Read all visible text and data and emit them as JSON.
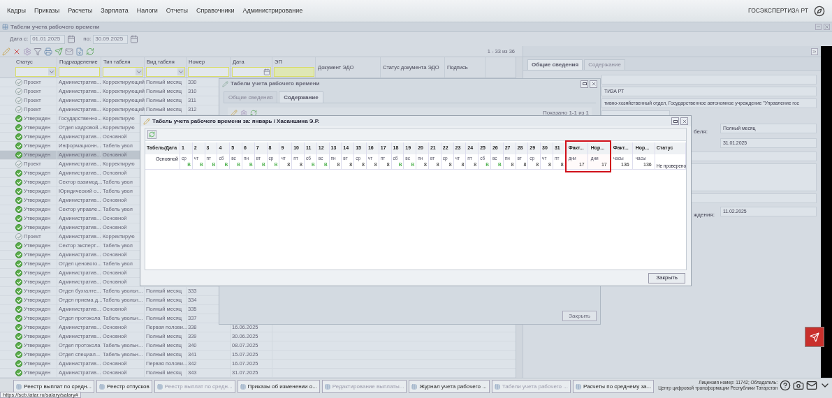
{
  "menu": {
    "items": [
      "Кадры",
      "Приказы",
      "Расчеты",
      "Зарплата",
      "Налоги",
      "Отчеты",
      "Справочники",
      "Администрирование"
    ],
    "org": "ГОСЭКСПЕРТИЗА РТ"
  },
  "panel": {
    "title": "Табели учета рабочего времени",
    "date_from_label": "Дата с:",
    "date_from": "01.01.2025",
    "date_to_label": "по:",
    "date_to": "30.09.2025",
    "pager": "1 - 33 из 36"
  },
  "grid": {
    "columns": [
      {
        "label": "Статус",
        "kind": "select"
      },
      {
        "label": "Подразделение",
        "kind": "text"
      },
      {
        "label": "Тип табеля",
        "kind": "select"
      },
      {
        "label": "Вид табеля",
        "kind": "select"
      },
      {
        "label": "Номер",
        "kind": "text"
      },
      {
        "label": "Дата",
        "kind": "date"
      },
      {
        "label": "ЭП",
        "kind": "sign"
      },
      {
        "label": "Документ ЭДО",
        "kind": "none"
      },
      {
        "label": "Статус документа ЭДО",
        "kind": "none"
      },
      {
        "label": "Подпись",
        "kind": "none"
      }
    ],
    "rows": [
      {
        "status": "Проект",
        "kind": "draft",
        "selected": false,
        "department": "Административ...",
        "type": "Корректирующий",
        "view": "Полный месяц",
        "number": "330"
      },
      {
        "status": "Проект",
        "kind": "draft",
        "selected": false,
        "department": "Административ...",
        "type": "Корректирующий",
        "view": "Полный месяц",
        "number": "310"
      },
      {
        "status": "Проект",
        "kind": "draft",
        "selected": false,
        "department": "Административ...",
        "type": "Корректирующий",
        "view": "Полный месяц",
        "number": "311"
      },
      {
        "status": "Проект",
        "kind": "draft",
        "selected": false,
        "department": "Административ...",
        "type": "Корректирующий",
        "view": "Полный месяц",
        "number": "312"
      },
      {
        "status": "Утвержден",
        "kind": "approved",
        "selected": false,
        "department": "Государственно...",
        "type": "Корректирую"
      },
      {
        "status": "Утвержден",
        "kind": "approved",
        "selected": false,
        "department": "Отдел кадровой...",
        "type": "Корректирую"
      },
      {
        "status": "Утвержден",
        "kind": "approved",
        "selected": false,
        "department": "Административ...",
        "type": "Основной"
      },
      {
        "status": "Утвержден",
        "kind": "approved",
        "selected": false,
        "department": "Информационн...",
        "type": "Табель увол"
      },
      {
        "status": "Утвержден",
        "kind": "approved",
        "selected": true,
        "department": "Административ...",
        "type": "Основной"
      },
      {
        "status": "Проект",
        "kind": "draft",
        "selected": false,
        "department": "Административ...",
        "type": "Корректирую"
      },
      {
        "status": "Утвержден",
        "kind": "approved",
        "selected": false,
        "department": "Административ...",
        "type": "Основной"
      },
      {
        "status": "Утвержден",
        "kind": "approved",
        "selected": false,
        "department": "Сектор взаимод...",
        "type": "Табель увол"
      },
      {
        "status": "Утвержден",
        "kind": "approved",
        "selected": false,
        "department": "Юридический о...",
        "type": "Табель увол"
      },
      {
        "status": "Утвержден",
        "kind": "approved",
        "selected": false,
        "department": "Административ...",
        "type": "Основной"
      },
      {
        "status": "Утвержден",
        "kind": "approved",
        "selected": false,
        "department": "Сектор управле...",
        "type": "Табель увол"
      },
      {
        "status": "Утвержден",
        "kind": "approved",
        "selected": false,
        "department": "Административ...",
        "type": "Основной"
      },
      {
        "status": "Утвержден",
        "kind": "approved",
        "selected": false,
        "department": "Административ...",
        "type": "Основной"
      },
      {
        "status": "Проект",
        "kind": "draft",
        "selected": false,
        "department": "Административ...",
        "type": "Корректирую"
      },
      {
        "status": "Утвержден",
        "kind": "approved",
        "selected": false,
        "department": "Сектор эксперт...",
        "type": "Табель увол"
      },
      {
        "status": "Утвержден",
        "kind": "approved",
        "selected": false,
        "department": "Административ...",
        "type": "Основной"
      },
      {
        "status": "Утвержден",
        "kind": "approved",
        "selected": false,
        "department": "Отдел ценового...",
        "type": "Табель увол"
      },
      {
        "status": "Утвержден",
        "kind": "approved",
        "selected": false,
        "department": "Административ...",
        "type": "Основной"
      },
      {
        "status": "Утвержден",
        "kind": "approved",
        "selected": false,
        "department": "Административ...",
        "type": "Основной"
      },
      {
        "status": "Утвержден",
        "kind": "approved",
        "selected": false,
        "department": "Отдел бухгалте...",
        "type": "Табель увольн...",
        "view": "Полный месяц",
        "number": "333"
      },
      {
        "status": "Утвержден",
        "kind": "approved",
        "selected": false,
        "department": "Отдел приема д...",
        "type": "Табель увольн...",
        "view": "Полный месяц",
        "number": "334"
      },
      {
        "status": "Утвержден",
        "kind": "approved",
        "selected": false,
        "department": "Административ...",
        "type": "Основной",
        "view": "Полный месяц",
        "number": "335"
      },
      {
        "status": "Утвержден",
        "kind": "approved",
        "selected": false,
        "department": "Отдел протокола",
        "type": "Табель увольн...",
        "view": "Полный месяц",
        "number": "337"
      },
      {
        "status": "Утвержден",
        "kind": "approved",
        "selected": false,
        "department": "Административ...",
        "type": "Основной",
        "view": "Первая полови...",
        "number": "338",
        "date": "16.06.2025"
      },
      {
        "status": "Утвержден",
        "kind": "approved",
        "selected": false,
        "department": "Административ...",
        "type": "Основной",
        "view": "Полный месяц",
        "number": "339",
        "date": "30.06.2025"
      },
      {
        "status": "Утвержден",
        "kind": "approved",
        "selected": false,
        "department": "Отдел протокола",
        "type": "Табель увольн...",
        "view": "Полный месяц",
        "number": "340",
        "date": "08.07.2025"
      },
      {
        "status": "Утвержден",
        "kind": "approved",
        "selected": false,
        "department": "Отдел специал...",
        "type": "Табель увольн...",
        "view": "Полный месяц",
        "number": "341",
        "date": "15.07.2025"
      },
      {
        "status": "Утвержден",
        "kind": "approved",
        "selected": false,
        "department": "Административ...",
        "type": "Основной",
        "view": "Первая полови...",
        "number": "342",
        "date": "16.07.2025"
      },
      {
        "status": "Утвержден",
        "kind": "approved",
        "selected": false,
        "department": "Административ...",
        "type": "Основной",
        "view": "Полный месяц",
        "number": "343",
        "date": "31.07.2025"
      }
    ]
  },
  "details": {
    "tabs": [
      {
        "label": "Общие сведения",
        "selected": true
      },
      {
        "label": "Содержание",
        "selected": false
      }
    ],
    "fields": [
      {
        "kind": "wide"
      },
      {
        "kind": "wide",
        "value": "ТИЗА РТ"
      },
      {
        "kind": "wide",
        "value": "тивно-хозяйственный отдел, Государственное автономное учреждение \"Управление гос"
      },
      {
        "kind": "short"
      },
      {
        "kind": "labeled",
        "label": "беля:",
        "value": "Полный месяц"
      },
      {
        "kind": "labeled",
        "value": "31.01.2025"
      },
      {
        "kind": "wide"
      },
      {
        "kind": "area"
      },
      {
        "kind": "wide"
      },
      {
        "kind": "labeled",
        "label": "ждения:",
        "value": "11.02.2025"
      }
    ]
  },
  "list_dialog": {
    "title": "Табели учета рабочего времени",
    "tabs": [
      {
        "label": "Общие сведения",
        "selected": false
      },
      {
        "label": "Содержание",
        "selected": true
      }
    ],
    "pager": "Показано 1-1 из 1",
    "close": "Закрыть"
  },
  "timesheet_dialog": {
    "title": "Табель учета рабочего времени за: январь / Хасаншина Э.Р.",
    "first": {
      "header": "Табель/Дата",
      "value": "Основной"
    },
    "days": [
      {
        "header": "1",
        "weekday": "ср",
        "value": "В",
        "kind": "off"
      },
      {
        "header": "2",
        "weekday": "чт",
        "value": "В",
        "kind": "off"
      },
      {
        "header": "3",
        "weekday": "пт",
        "value": "В",
        "kind": "off"
      },
      {
        "header": "4",
        "weekday": "сб",
        "value": "В",
        "kind": "off"
      },
      {
        "header": "5",
        "weekday": "вс",
        "value": "В",
        "kind": "off"
      },
      {
        "header": "6",
        "weekday": "пн",
        "value": "В",
        "kind": "off"
      },
      {
        "header": "7",
        "weekday": "вт",
        "value": "В",
        "kind": "off"
      },
      {
        "header": "8",
        "weekday": "ср",
        "value": "В",
        "kind": "off"
      },
      {
        "header": "9",
        "weekday": "чт",
        "value": "8",
        "kind": "work"
      },
      {
        "header": "10",
        "weekday": "пт",
        "value": "8",
        "kind": "work"
      },
      {
        "header": "11",
        "weekday": "сб",
        "value": "В",
        "kind": "off"
      },
      {
        "header": "12",
        "weekday": "вс",
        "value": "В",
        "kind": "off"
      },
      {
        "header": "13",
        "weekday": "пн",
        "value": "8",
        "kind": "work"
      },
      {
        "header": "14",
        "weekday": "вт",
        "value": "8",
        "kind": "work"
      },
      {
        "header": "15",
        "weekday": "ср",
        "value": "8",
        "kind": "work"
      },
      {
        "header": "16",
        "weekday": "чт",
        "value": "8",
        "kind": "work"
      },
      {
        "header": "17",
        "weekday": "пт",
        "value": "8",
        "kind": "work"
      },
      {
        "header": "18",
        "weekday": "сб",
        "value": "В",
        "kind": "off"
      },
      {
        "header": "19",
        "weekday": "вс",
        "value": "В",
        "kind": "off"
      },
      {
        "header": "20",
        "weekday": "пн",
        "value": "8",
        "kind": "work"
      },
      {
        "header": "21",
        "weekday": "вт",
        "value": "8",
        "kind": "work"
      },
      {
        "header": "22",
        "weekday": "ср",
        "value": "8",
        "kind": "work"
      },
      {
        "header": "23",
        "weekday": "чт",
        "value": "8",
        "kind": "work"
      },
      {
        "header": "24",
        "weekday": "пт",
        "value": "8",
        "kind": "work"
      },
      {
        "header": "25",
        "weekday": "сб",
        "value": "В",
        "kind": "off"
      },
      {
        "header": "26",
        "weekday": "вс",
        "value": "В",
        "kind": "off"
      },
      {
        "header": "27",
        "weekday": "пн",
        "value": "8",
        "kind": "work"
      },
      {
        "header": "28",
        "weekday": "вт",
        "value": "8",
        "kind": "work"
      },
      {
        "header": "29",
        "weekday": "ср",
        "value": "8",
        "kind": "work"
      },
      {
        "header": "30",
        "weekday": "чт",
        "value": "8",
        "kind": "work"
      },
      {
        "header": "31",
        "weekday": "пт",
        "value": "8",
        "kind": "work"
      }
    ],
    "totals": [
      {
        "header": "Факт...",
        "unit": "дни",
        "value": "17",
        "highlighted": true
      },
      {
        "header": "Нор...",
        "unit": "дни",
        "value": "17",
        "highlighted": true
      },
      {
        "header": "Факт...",
        "unit": "часы",
        "value": "136",
        "highlighted": false
      },
      {
        "header": "Нор...",
        "unit": "часы",
        "value": "136",
        "highlighted": false
      }
    ],
    "status": {
      "header": "Статус",
      "value": "Не проверено"
    },
    "close": "Закрыть"
  },
  "taskbar": {
    "items": [
      {
        "label": "Реестр выплат по средн...",
        "dimmed": false
      },
      {
        "label": "Реестр отпусков",
        "dimmed": false
      },
      {
        "label": "Реестр выплат по средн...",
        "dimmed": true
      },
      {
        "label": "Приказы об изменении о...",
        "dimmed": false
      },
      {
        "label": "Редактирование выплаты...",
        "dimmed": true
      },
      {
        "label": "Журнал учета рабочего ...",
        "dimmed": false
      },
      {
        "label": "Табели учета рабочего ...",
        "dimmed": true
      },
      {
        "label": "Расчеты по среднему за...",
        "dimmed": false
      }
    ],
    "license": [
      "Лицензия номер: 11742; Обладатель:",
      "Центр цифровой трансформации Республики Татарстан"
    ],
    "url": "https://scb.tatar.ru/salary/salary#"
  }
}
